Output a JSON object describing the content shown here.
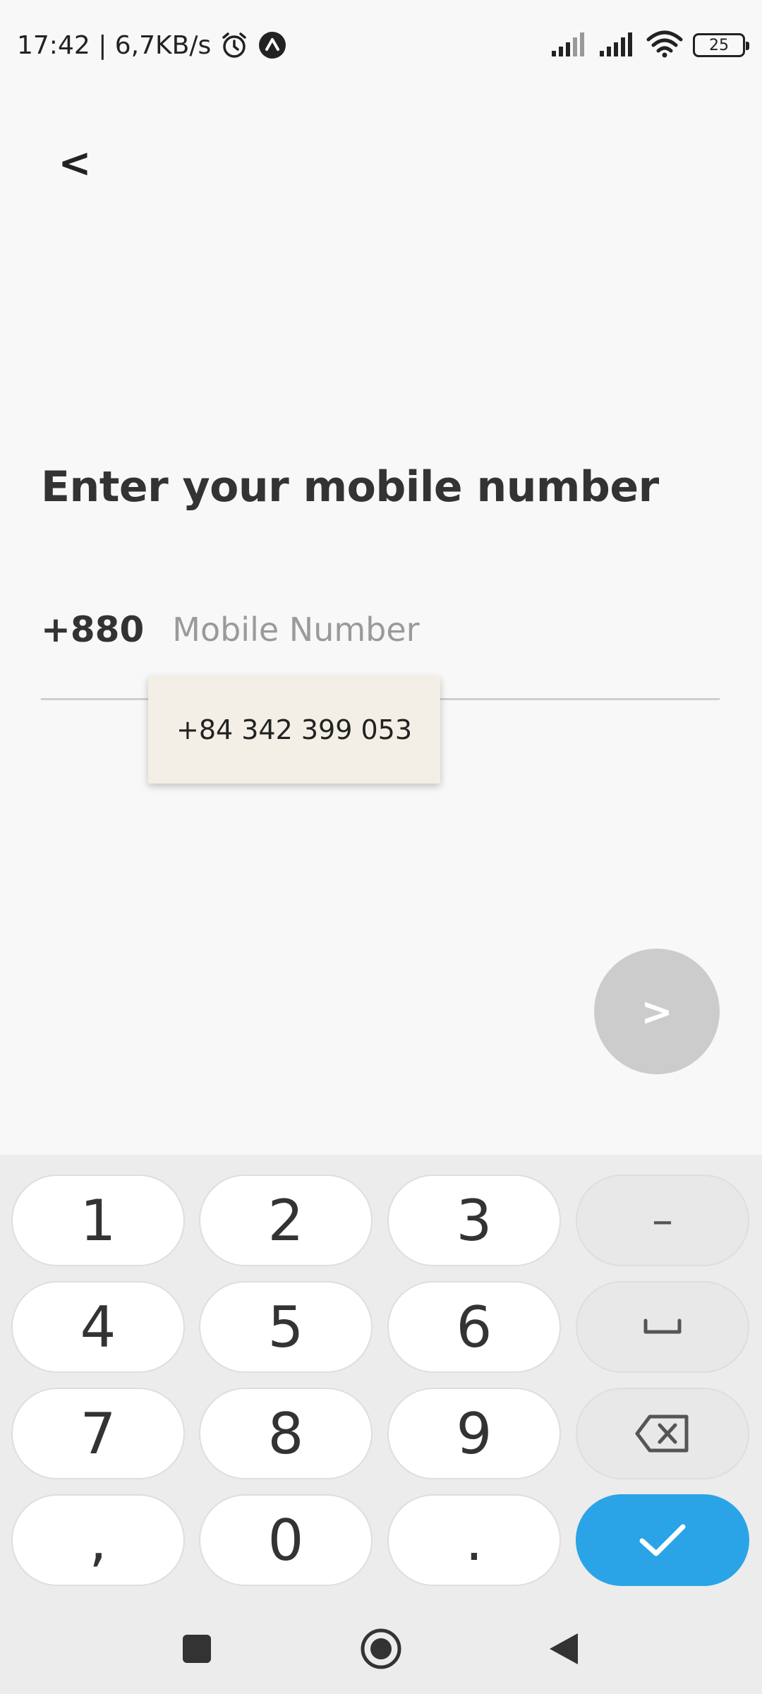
{
  "status_bar": {
    "time_speed": "17:42 | 6,7KB/s",
    "battery": "25",
    "icons": [
      "alarm-icon",
      "up-arrow-badge-icon",
      "signal-weak-icon",
      "signal-icon",
      "wifi-icon",
      "battery-icon"
    ]
  },
  "header": {
    "back_label": "<"
  },
  "main": {
    "title": "Enter your mobile number",
    "country_code": "+880",
    "mobile_placeholder": "Mobile Number",
    "mobile_value": "",
    "autofill_suggestion": "+84 342 399 053",
    "next_label": ">"
  },
  "keyboard": {
    "keys": [
      "1",
      "2",
      "3",
      "–",
      "4",
      "5",
      "6",
      "␣",
      "7",
      "8",
      "9",
      "⌫",
      ",",
      "0",
      ".",
      "✓"
    ],
    "accent_color": "#2aa4e6"
  },
  "nav_bar": {
    "icons": [
      "recents-square-icon",
      "home-circle-icon",
      "back-triangle-icon"
    ]
  }
}
